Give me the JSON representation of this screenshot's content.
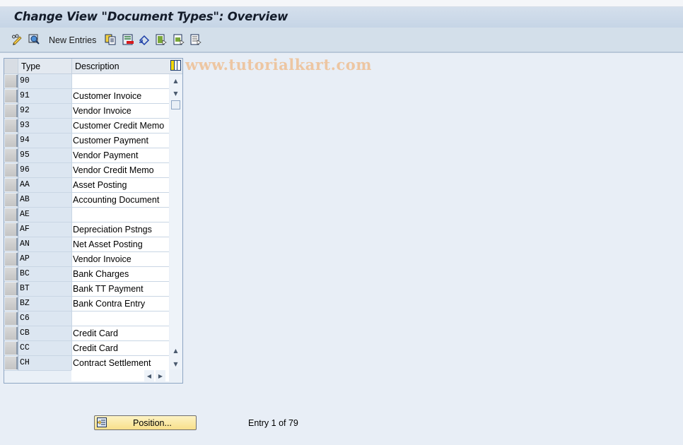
{
  "window": {
    "title": "Change View \"Document Types\": Overview"
  },
  "toolbar": {
    "items": [
      {
        "icon": "display-change-icon"
      },
      {
        "icon": "find-icon"
      },
      {
        "label": "New Entries"
      },
      {
        "icon": "copy-icon"
      },
      {
        "icon": "delete-icon"
      },
      {
        "icon": "undo-change-icon"
      },
      {
        "icon": "select-all-icon"
      },
      {
        "icon": "select-block-icon"
      },
      {
        "icon": "deselect-all-icon"
      }
    ],
    "new_entries_label": "New Entries"
  },
  "watermark": "www.tutorialkart.com",
  "table": {
    "columns": [
      "Type",
      "Description"
    ],
    "rows": [
      {
        "type": "90",
        "description": ""
      },
      {
        "type": "91",
        "description": "Customer Invoice"
      },
      {
        "type": "92",
        "description": "Vendor Invoice"
      },
      {
        "type": "93",
        "description": "Customer Credit Memo"
      },
      {
        "type": "94",
        "description": "Customer Payment"
      },
      {
        "type": "95",
        "description": "Vendor Payment"
      },
      {
        "type": "96",
        "description": "Vendor Credit Memo"
      },
      {
        "type": "AA",
        "description": "Asset Posting"
      },
      {
        "type": "AB",
        "description": "Accounting Document"
      },
      {
        "type": "AE",
        "description": ""
      },
      {
        "type": "AF",
        "description": "Depreciation Pstngs"
      },
      {
        "type": "AN",
        "description": "Net Asset Posting"
      },
      {
        "type": "AP",
        "description": "Vendor Invoice"
      },
      {
        "type": "BC",
        "description": "Bank Charges"
      },
      {
        "type": "BT",
        "description": "Bank TT Payment"
      },
      {
        "type": "BZ",
        "description": "Bank Contra Entry"
      },
      {
        "type": "C6",
        "description": ""
      },
      {
        "type": "CB",
        "description": "Credit Card"
      },
      {
        "type": "CC",
        "description": "Credit Card"
      },
      {
        "type": "CH",
        "description": "Contract Settlement"
      }
    ]
  },
  "footer": {
    "position_button_label": "Position...",
    "entry_info": "Entry 1 of 79"
  }
}
